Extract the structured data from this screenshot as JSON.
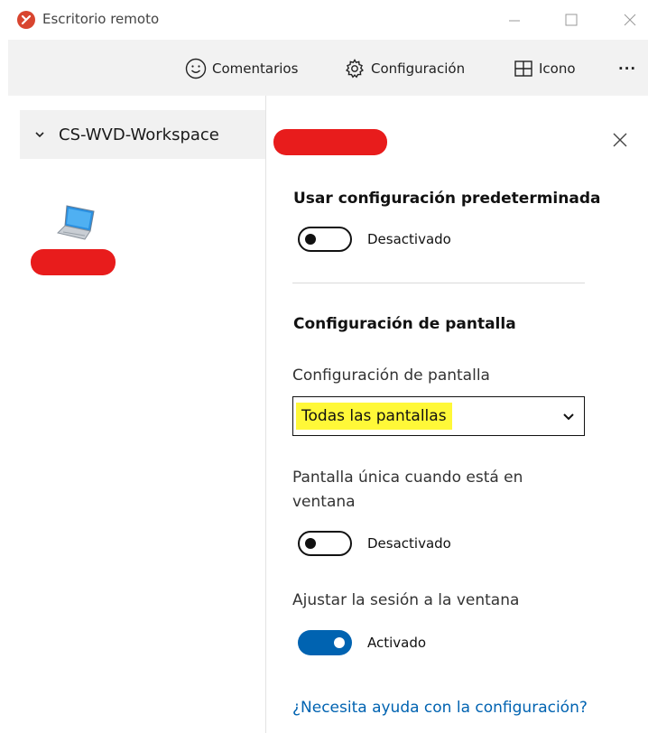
{
  "window": {
    "title": "Escritorio remoto",
    "controls": [
      "minimize",
      "maximize",
      "close"
    ]
  },
  "toolbar": {
    "feedback_label": "Comentarios",
    "settings_label": "Configuración",
    "tile_label": "Icono",
    "more_label": "···"
  },
  "sidebar": {
    "workspace_name": "CS-WVD-Workspace"
  },
  "panel": {
    "default_settings_heading": "Usar configuración predeterminada",
    "default_settings_toggle": {
      "state": "off",
      "label": "Desactivado"
    },
    "display_heading": "Configuración de pantalla",
    "display_field_label": "Configuración de pantalla",
    "display_select": {
      "value": "Todas las pantallas"
    },
    "single_display_label": "Pantalla única cuando está en ventana",
    "single_display_toggle": {
      "state": "off",
      "label": "Desactivado"
    },
    "fit_session_label": "Ajustar la sesión a la ventana",
    "fit_session_toggle": {
      "state": "on",
      "label": "Activado"
    },
    "help_link": "¿Necesita ayuda con la configuración?"
  },
  "colors": {
    "accent": "#0063b1",
    "redaction": "#e81c1c",
    "highlight": "#fff838",
    "app_icon": "#d8452f"
  }
}
